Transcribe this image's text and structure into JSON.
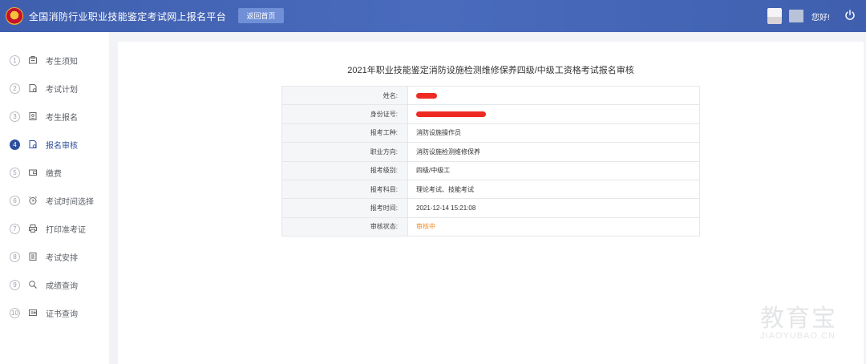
{
  "header": {
    "site_title": "全国消防行业职业技能鉴定考试网上报名平台",
    "home_button": "返回首页",
    "greeting": "您好!"
  },
  "sidebar": {
    "items": [
      {
        "num": "1",
        "label": "考生须知",
        "icon": "id-card-icon"
      },
      {
        "num": "2",
        "label": "考试计划",
        "icon": "document-icon"
      },
      {
        "num": "3",
        "label": "考生报名",
        "icon": "form-icon"
      },
      {
        "num": "4",
        "label": "报名审核",
        "icon": "review-icon",
        "active": true
      },
      {
        "num": "5",
        "label": "缴费",
        "icon": "wallet-icon"
      },
      {
        "num": "6",
        "label": "考试时间选择",
        "icon": "clock-icon"
      },
      {
        "num": "7",
        "label": "打印准考证",
        "icon": "printer-icon"
      },
      {
        "num": "8",
        "label": "考试安排",
        "icon": "building-icon"
      },
      {
        "num": "9",
        "label": "成绩查询",
        "icon": "search-icon"
      },
      {
        "num": "10",
        "label": "证书查询",
        "icon": "certificate-icon"
      }
    ]
  },
  "main": {
    "title": "2021年职业技能鉴定消防设施检测维修保养四级/中级工资格考试报名审核",
    "rows": [
      {
        "label": "姓名:",
        "value": ""
      },
      {
        "label": "身份证号:",
        "value": ""
      },
      {
        "label": "报考工种:",
        "value": "消防设施操作员"
      },
      {
        "label": "职业方向:",
        "value": "消防设施检测维修保养"
      },
      {
        "label": "报考级别:",
        "value": "四级/中级工"
      },
      {
        "label": "报考科目:",
        "value": "理论考试、技能考试"
      },
      {
        "label": "报考时间:",
        "value": "2021-12-14 15:21:08"
      },
      {
        "label": "审核状态:",
        "value": "审核中"
      }
    ]
  },
  "watermark": {
    "big": "教育宝",
    "small": "JIAOYUBAO.CN"
  },
  "colors": {
    "header_bg": "#4060b0",
    "active": "#2e4f9e",
    "status": "#f08a24",
    "redaction": "#ee2a23"
  }
}
